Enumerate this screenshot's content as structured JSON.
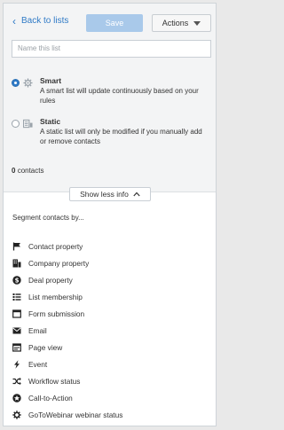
{
  "header": {
    "back_label": "Back to lists",
    "save_label": "Save",
    "actions_label": "Actions"
  },
  "name_input": {
    "placeholder": "Name this list"
  },
  "list_types": {
    "smart": {
      "title": "Smart",
      "description": "A smart list will update continuously based on your rules",
      "selected": true
    },
    "static": {
      "title": "Static",
      "description": "A static list will only be modified if you manually add or remove contacts",
      "selected": false
    }
  },
  "contact_count": {
    "value": "0",
    "label": "contacts"
  },
  "toggle": {
    "label": "Show less info"
  },
  "segment": {
    "title": "Segment contacts by...",
    "items": [
      {
        "label": "Contact property",
        "icon": "flag-icon"
      },
      {
        "label": "Company property",
        "icon": "building-icon"
      },
      {
        "label": "Deal property",
        "icon": "dollar-icon"
      },
      {
        "label": "List membership",
        "icon": "list-icon"
      },
      {
        "label": "Form submission",
        "icon": "form-icon"
      },
      {
        "label": "Email",
        "icon": "email-icon"
      },
      {
        "label": "Page view",
        "icon": "page-icon"
      },
      {
        "label": "Event",
        "icon": "bolt-icon"
      },
      {
        "label": "Workflow status",
        "icon": "shuffle-icon"
      },
      {
        "label": "Call-to-Action",
        "icon": "cta-icon"
      },
      {
        "label": "GoToWebinar webinar status",
        "icon": "gear-icon"
      }
    ]
  },
  "colors": {
    "accent": "#2f7ac6",
    "save_bg": "#a9c9ea",
    "panel_bg": "#f3f4f5"
  }
}
